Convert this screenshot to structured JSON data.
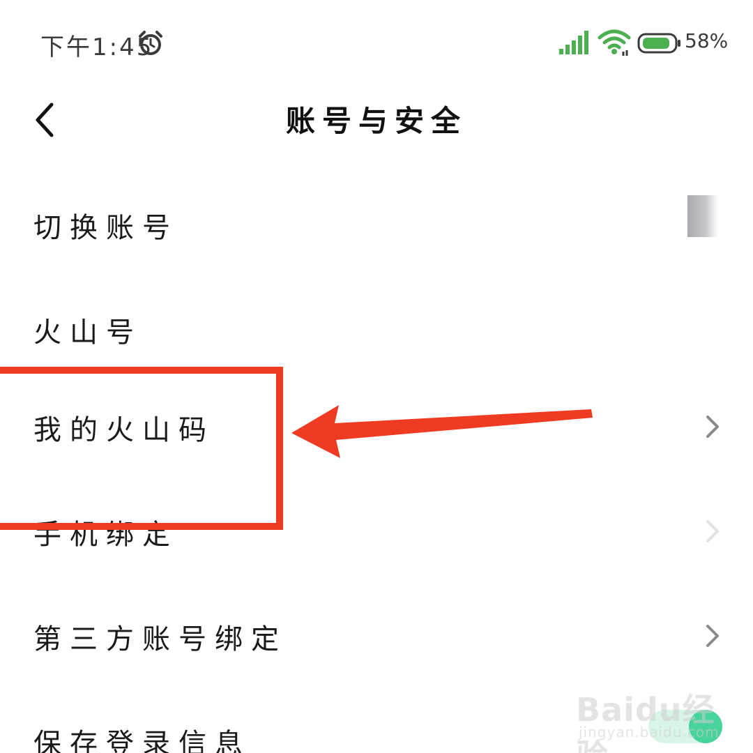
{
  "status_bar": {
    "time": "下午1:45",
    "battery_percent": "58%",
    "icons": [
      "alarm-icon",
      "signal-icon",
      "wifi-icon",
      "battery-icon"
    ]
  },
  "header": {
    "title": "账号与安全",
    "back_icon": "chevron-left-icon"
  },
  "settings": {
    "items": [
      {
        "label": "切换账号"
      },
      {
        "label": "火山号"
      },
      {
        "label": "我的火山码"
      },
      {
        "label": "手机绑定"
      },
      {
        "label": "第三方账号绑定"
      },
      {
        "label": "保存登录信息",
        "toggle_on": true
      }
    ]
  },
  "watermark": {
    "brand": "Baidu经验",
    "url": "jingyan.baidu.com"
  },
  "colors": {
    "annotation_red": "#ee3b22",
    "toggle_green": "#47d39b",
    "status_green": "#4caf50",
    "text_dark": "#1a1a1a"
  }
}
